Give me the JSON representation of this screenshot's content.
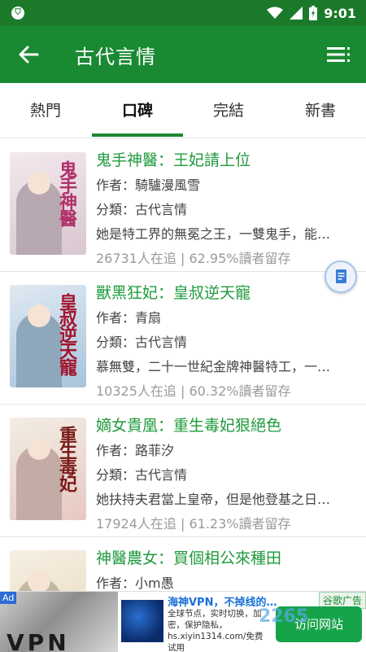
{
  "status_bar": {
    "time": "9:01"
  },
  "app_bar": {
    "title": "古代言情"
  },
  "tabs": [
    {
      "label": "熱門",
      "active": false
    },
    {
      "label": "口碑",
      "active": true
    },
    {
      "label": "完結",
      "active": false
    },
    {
      "label": "新書",
      "active": false
    }
  ],
  "books": [
    {
      "title": "鬼手神醫：王妃請上位",
      "author": "作者：騎驢漫風雪",
      "category": "分類：古代言情",
      "summary": "她是特工界的無冕之王，一雙鬼手，能…",
      "stats": "26731人在追 | 62.95%讀者留存",
      "cover_text": "鬼手神醫",
      "cover_colors": [
        "#f3e9ee",
        "#d9c6d0",
        "#b0306a"
      ]
    },
    {
      "title": "獸黑狂妃：皇叔逆天寵",
      "author": "作者：青扇",
      "category": "分類：古代言情",
      "summary": "慕無雙，二十一世紀金牌神醫特工，一…",
      "stats": "10325人在追 | 60.32%讀者留存",
      "cover_text": "皇叔逆天寵",
      "cover_colors": [
        "#dfe9f2",
        "#a8c4dc",
        "#a2142c"
      ]
    },
    {
      "title": "嫡女貴凰：重生毒妃狠絕色",
      "author": "作者：路菲汐",
      "category": "分類：古代言情",
      "summary": "她扶持夫君當上皇帝，但是他登基之日…",
      "stats": "17924人在追 | 61.23%讀者留存",
      "cover_text": "重生毒妃",
      "cover_colors": [
        "#f2ede3",
        "#e6c9c2",
        "#7a1a1a"
      ]
    },
    {
      "title": "神醫農女：買個相公來種田",
      "author": "作者：小m愚",
      "category": "",
      "summary": "",
      "stats": "",
      "cover_text": "",
      "cover_colors": [
        "#f6efe2",
        "#e8d9c0",
        "#5a2a10"
      ]
    }
  ],
  "ad": {
    "tag": "Ad",
    "image_text": "VPN",
    "name": "海神VPN，不掉线的…",
    "description": "全球节点，实时切换，加密，保护隐私，hs.xiyin1314.com/免费试用",
    "label": "谷歌广告",
    "button": "访问网站"
  },
  "watermark": "2265"
}
